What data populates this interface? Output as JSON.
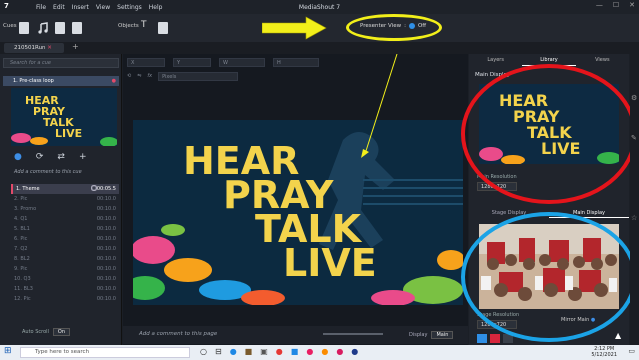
{
  "app": {
    "number": "7",
    "title": "MediaShout 7",
    "menu": [
      "File",
      "Edit",
      "Insert",
      "View",
      "Settings",
      "Help"
    ]
  },
  "toolbar": {
    "cues_label": "Cues",
    "objects_label": "Objects",
    "presenter_view_label": "Presenter View",
    "presenter_view_state": "Off"
  },
  "tabs": [
    {
      "label": "210501Run"
    }
  ],
  "left_panel": {
    "search_placeholder": "Search for a cue",
    "cue_title": "1. Pre-class loop",
    "add_comment": "Add a comment to this cue",
    "items": [
      {
        "label": "1. Theme",
        "time": "00:05.5"
      },
      {
        "label": "2. Pic",
        "time": "00:10.0"
      },
      {
        "label": "3. Promo",
        "time": "00:10.0"
      },
      {
        "label": "4. Q1",
        "time": "00:10.0"
      },
      {
        "label": "5. BL1",
        "time": "00:10.0"
      },
      {
        "label": "6. Pic",
        "time": "00:10.0"
      },
      {
        "label": "7. Q2",
        "time": "00:10.0"
      },
      {
        "label": "8. BL2",
        "time": "00:10.0"
      },
      {
        "label": "9. Pic",
        "time": "00:10.0"
      },
      {
        "label": "10. Q3",
        "time": "00:10.0"
      },
      {
        "label": "11. BL3",
        "time": "00:10.0"
      },
      {
        "label": "12. Pic",
        "time": "00:10.0"
      }
    ],
    "auto_scroll_label": "Auto Scroll",
    "auto_scroll_state": "On"
  },
  "editor": {
    "fields": [
      "X",
      "Y",
      "W",
      "H"
    ],
    "units": "Pixels",
    "comment_placeholder": "Add a comment to this page",
    "display_label": "Display",
    "display_value": "Main"
  },
  "slide": {
    "lines": [
      "HEAR",
      "PRAY",
      "TALK",
      "LIVE"
    ]
  },
  "right_panel": {
    "tabs": [
      "Layers",
      "Library",
      "Views"
    ],
    "main_display_label": "Main Display",
    "resolution_label": "Main Resolution",
    "resolution_value": "1280x720",
    "stage_tabs": [
      "Stage Display",
      "Main Display"
    ],
    "resolution2_label": "Stage Resolution",
    "resolution2_value": "1280x720",
    "mirror_label": "Mirror Main"
  },
  "taskbar": {
    "search_placeholder": "Type here to search",
    "time": "2:12 PM",
    "date": "5/12/2021"
  },
  "colors": {
    "annotation_yellow": "#f2ef1a",
    "annotation_red": "#e4141b",
    "annotation_blue": "#1ba3e6",
    "slide_text": "#f3d34c"
  }
}
